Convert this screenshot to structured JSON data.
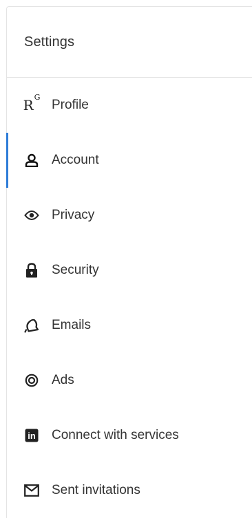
{
  "header": {
    "title": "Settings"
  },
  "nav": {
    "items": [
      {
        "id": "profile",
        "label": "Profile",
        "icon": "researchgate-logo-icon",
        "logo_text": "R",
        "logo_sup": "G"
      },
      {
        "id": "account",
        "label": "Account",
        "icon": "person-icon",
        "active": true
      },
      {
        "id": "privacy",
        "label": "Privacy",
        "icon": "eye-icon"
      },
      {
        "id": "security",
        "label": "Security",
        "icon": "lock-icon"
      },
      {
        "id": "emails",
        "label": "Emails",
        "icon": "bell-icon"
      },
      {
        "id": "ads",
        "label": "Ads",
        "icon": "target-icon"
      },
      {
        "id": "connect",
        "label": "Connect with services",
        "icon": "linkedin-icon",
        "logo_text": "in"
      },
      {
        "id": "invitations",
        "label": "Sent invitations",
        "icon": "envelope-icon"
      }
    ]
  },
  "colors": {
    "accent": "#2e7cd8",
    "text": "#333333",
    "divider": "#e4e4e4"
  }
}
